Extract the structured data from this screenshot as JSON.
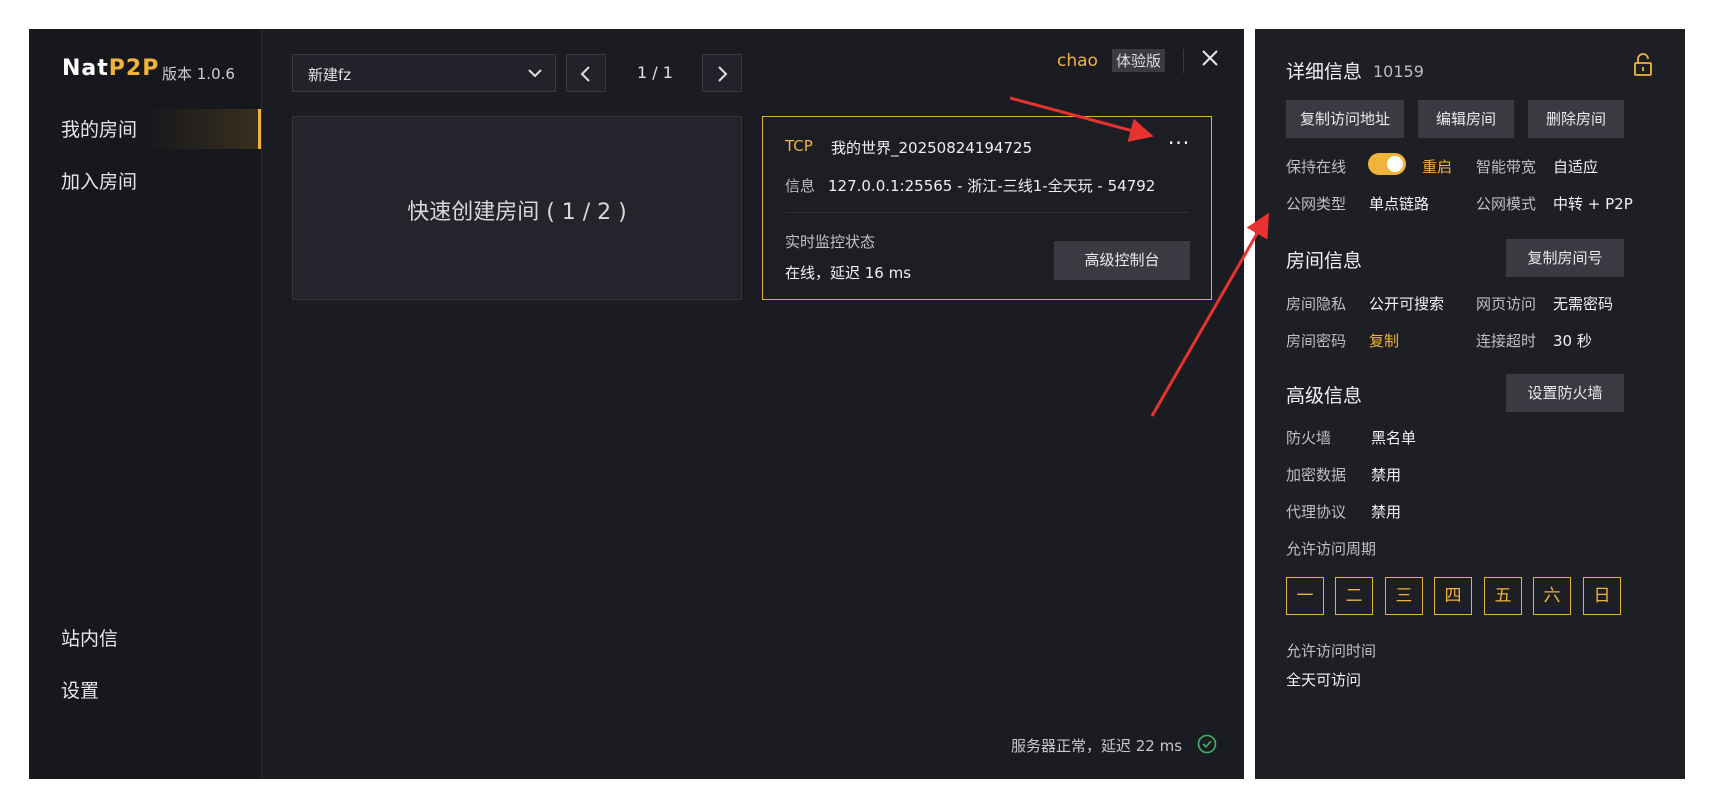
{
  "brand": {
    "name_prefix": "Nat",
    "name_suffix": "P2P",
    "version": "版本 1.0.6"
  },
  "sidebar": {
    "items": [
      {
        "label": "我的房间",
        "active": true
      },
      {
        "label": "加入房间"
      },
      {
        "label": "站内信"
      },
      {
        "label": "设置"
      }
    ]
  },
  "toolbar": {
    "select_value": "新建fz",
    "pager": "1 / 1",
    "user": "chao",
    "badge": "体验版"
  },
  "quick_create": {
    "label": "快速创建房间 ( 1 / 2 )"
  },
  "room_card": {
    "protocol": "TCP",
    "name": "我的世界_20250824194725",
    "more": "···",
    "info_label": "信息",
    "info_value": "127.0.0.1:25565 - 浙江-三线1-全天玩 - 54792",
    "monitor_label": "实时监控状态",
    "monitor_value": "在线，延迟 16 ms",
    "advanced_button": "高级控制台"
  },
  "status_bar": {
    "text": "服务器正常，延迟 22 ms"
  },
  "detail": {
    "title": "详细信息",
    "id": "10159",
    "buttons": [
      "复制访问地址",
      "编辑房间",
      "删除房间"
    ],
    "keep_online_label": "保持在线",
    "keep_online_on": true,
    "restart": "重启",
    "smart_bw_label": "智能带宽",
    "smart_bw_value": "自适应",
    "net_type_label": "公网类型",
    "net_type_value": "单点链路",
    "net_mode_label": "公网模式",
    "net_mode_value": "中转 + P2P",
    "room_info_title": "房间信息",
    "copy_room_no": "复制房间号",
    "privacy_label": "房间隐私",
    "privacy_value": "公开可搜索",
    "web_label": "网页访问",
    "web_value": "无需密码",
    "pwd_label": "房间密码",
    "pwd_value": "复制",
    "timeout_label": "连接超时",
    "timeout_value": "30 秒",
    "adv_title": "高级信息",
    "firewall_button": "设置防火墙",
    "firewall_label": "防火墙",
    "firewall_value": "黑名单",
    "encrypt_label": "加密数据",
    "encrypt_value": "禁用",
    "proxy_label": "代理协议",
    "proxy_value": "禁用",
    "period_label": "允许访问周期",
    "days": [
      "一",
      "二",
      "三",
      "四",
      "五",
      "六",
      "日"
    ],
    "time_label": "允许访问时间",
    "time_value": "全天可访问"
  },
  "colors": {
    "accent": "#f0b43c",
    "bg": "#1b1c22",
    "annotation": "#e8322f"
  }
}
